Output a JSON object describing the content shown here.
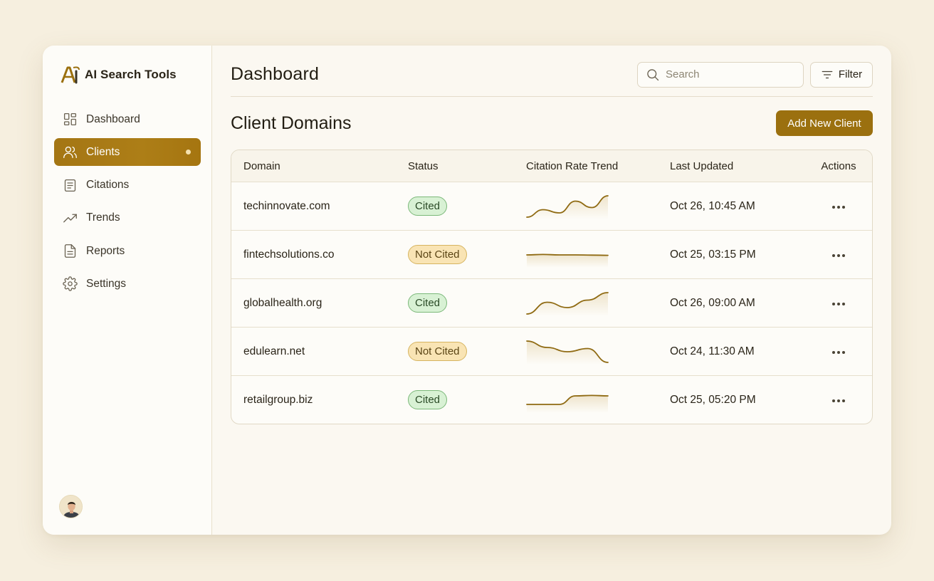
{
  "app": {
    "name": "AI Search Tools"
  },
  "sidebar": {
    "items": [
      {
        "label": "Dashboard",
        "icon": "dashboard-icon",
        "active": false
      },
      {
        "label": "Clients",
        "icon": "users-icon",
        "active": true
      },
      {
        "label": "Citations",
        "icon": "document-list-icon",
        "active": false
      },
      {
        "label": "Trends",
        "icon": "trend-up-icon",
        "active": false
      },
      {
        "label": "Reports",
        "icon": "file-report-icon",
        "active": false
      },
      {
        "label": "Settings",
        "icon": "gear-icon",
        "active": false
      }
    ]
  },
  "header": {
    "title": "Dashboard",
    "search_placeholder": "Search",
    "filter_label": "Filter"
  },
  "section": {
    "title": "Client Domains",
    "add_button": "Add New Client"
  },
  "table": {
    "columns": [
      "Domain",
      "Status",
      "Citation Rate Trend",
      "Last Updated",
      "Actions"
    ],
    "rows": [
      {
        "domain": "techinnovate.com",
        "status": "Cited",
        "cited": true,
        "trend": [
          0.0,
          0.35,
          0.2,
          0.75,
          0.45,
          1.0
        ],
        "updated": "Oct 26, 10:45 AM"
      },
      {
        "domain": "fintechsolutions.co",
        "status": "Not Cited",
        "cited": false,
        "trend": [
          0.5,
          0.52,
          0.5,
          0.5,
          0.49,
          0.48
        ],
        "updated": "Oct 25, 03:15 PM"
      },
      {
        "domain": "globalhealth.org",
        "status": "Cited",
        "cited": true,
        "trend": [
          0.0,
          0.55,
          0.3,
          0.65,
          1.0
        ],
        "updated": "Oct 26, 09:00 AM"
      },
      {
        "domain": "edulearn.net",
        "status": "Not Cited",
        "cited": false,
        "trend": [
          1.0,
          0.7,
          0.5,
          0.65,
          0.0
        ],
        "updated": "Oct 24, 11:30 AM"
      },
      {
        "domain": "retailgroup.biz",
        "status": "Cited",
        "cited": true,
        "trend": [
          0.3,
          0.3,
          0.3,
          0.7,
          0.72,
          0.7
        ],
        "updated": "Oct 25, 05:20 PM"
      }
    ]
  },
  "colors": {
    "accent": "#9b700f",
    "spark_line": "#8f6a12",
    "cited_bg": "#d8f1d4",
    "not_cited_bg": "#f9e4b4"
  }
}
